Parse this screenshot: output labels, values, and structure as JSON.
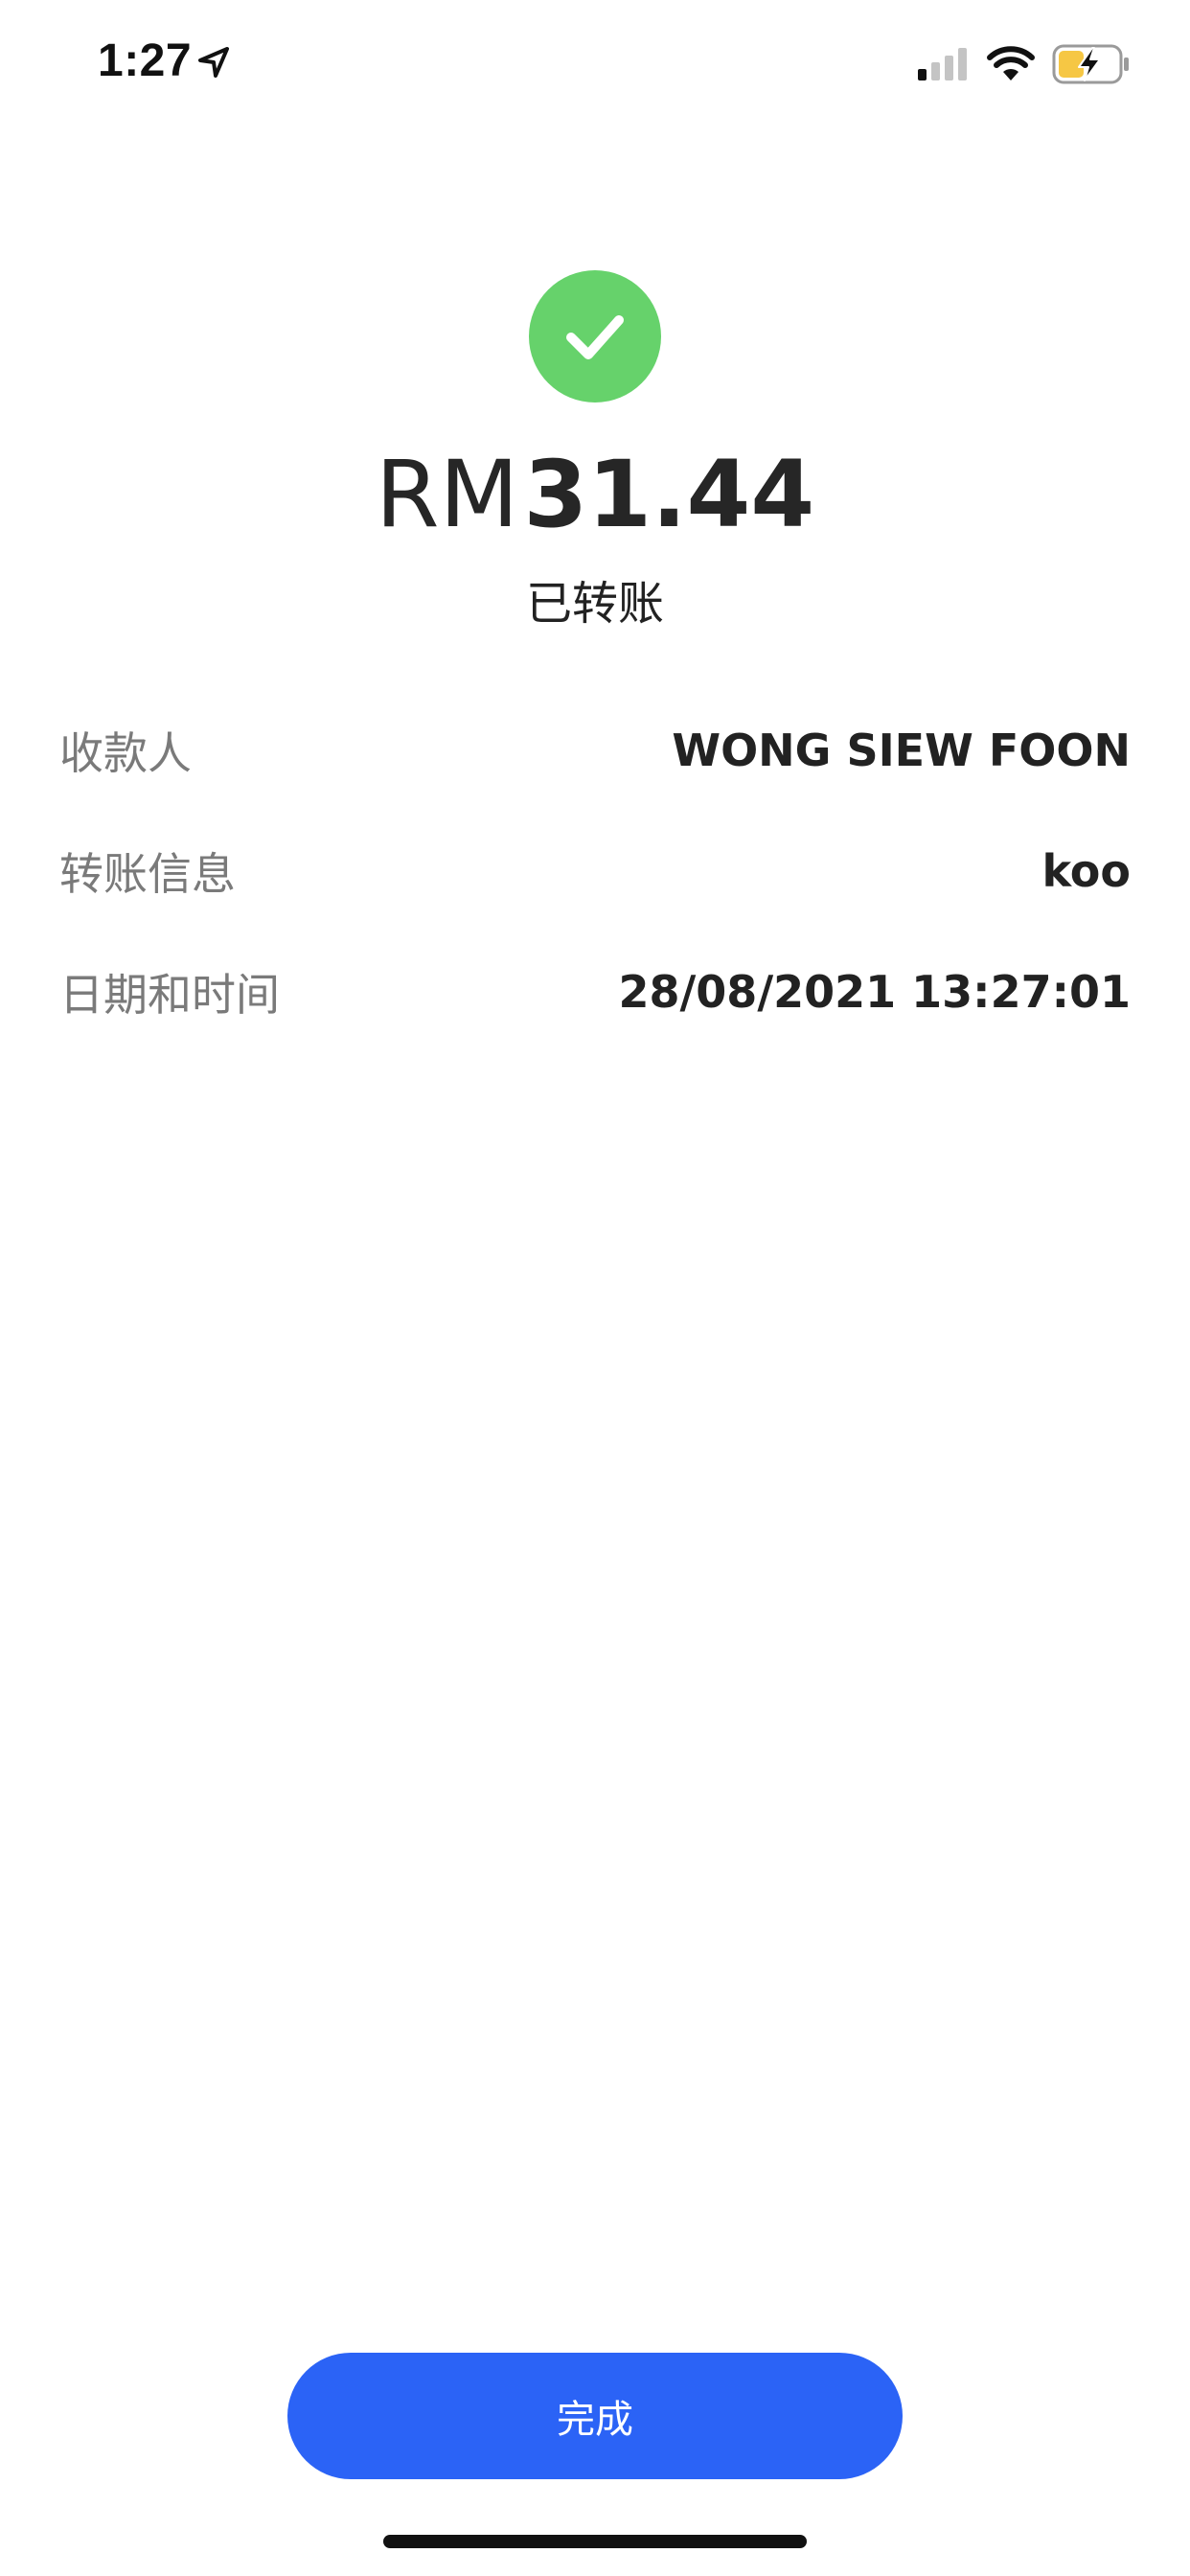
{
  "status_bar": {
    "time": "1:27",
    "icons": [
      "location-arrow-icon",
      "cellular-signal-icon",
      "wifi-icon",
      "battery-charging-icon"
    ]
  },
  "receipt": {
    "icon": "check-icon",
    "currency": "RM",
    "amount": "31.44",
    "status": "已转账"
  },
  "details": [
    {
      "label": "收款人",
      "value": "WONG SIEW FOON"
    },
    {
      "label": "转账信息",
      "value": "koo"
    },
    {
      "label": "日期和时间",
      "value": "28/08/2021 13:27:01"
    }
  ],
  "actions": {
    "done_label": "完成"
  },
  "colors": {
    "success_green": "#66d26b",
    "primary_blue": "#2b63f6",
    "label_gray": "#7a7a7a",
    "battery_yellow": "#f6c744"
  }
}
